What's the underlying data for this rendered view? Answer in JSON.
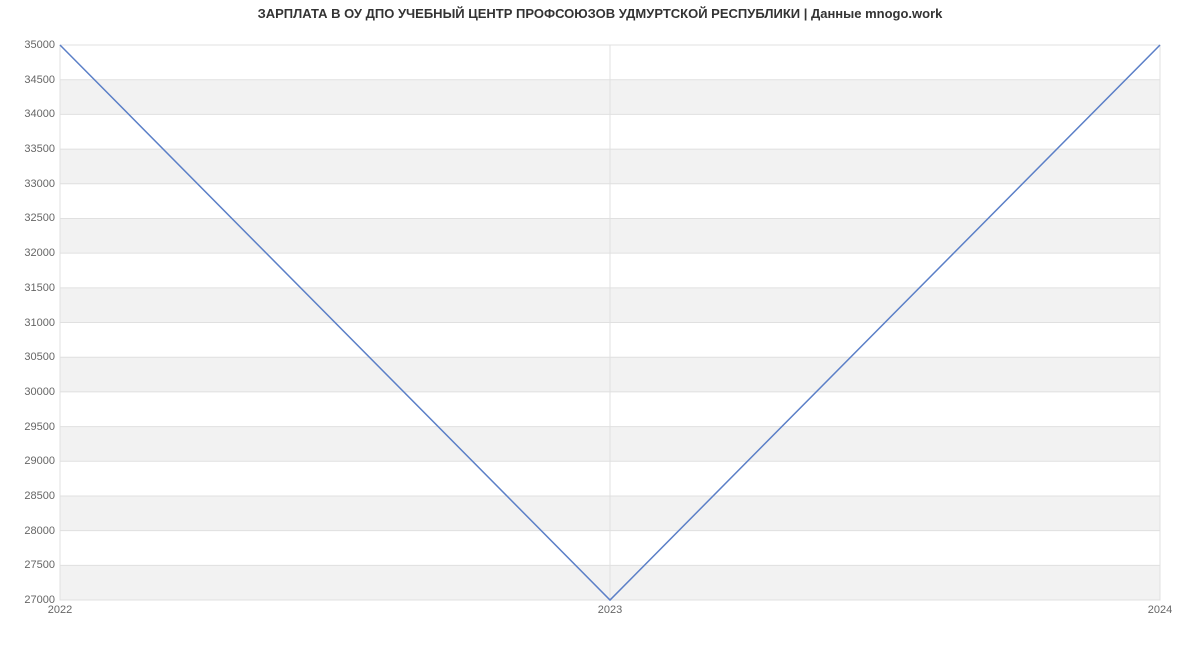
{
  "chart_data": {
    "type": "line",
    "title": "ЗАРПЛАТА В ОУ ДПО УЧЕБНЫЙ ЦЕНТР ПРОФСОЮЗОВ УДМУРТСКОЙ РЕСПУБЛИКИ | Данные mnogo.work",
    "x": [
      "2022",
      "2023",
      "2024"
    ],
    "y": [
      35000,
      27000,
      35000
    ],
    "x_ticks": [
      "2022",
      "2023",
      "2024"
    ],
    "y_ticks": [
      27000,
      27500,
      28000,
      28500,
      29000,
      29500,
      30000,
      30500,
      31000,
      31500,
      32000,
      32500,
      33000,
      33500,
      34000,
      34500,
      35000
    ],
    "ylim": [
      27000,
      35000
    ],
    "line_color": "#5b7fc7",
    "band_color": "#f2f2f2",
    "grid_line": "#e0e0e0"
  }
}
